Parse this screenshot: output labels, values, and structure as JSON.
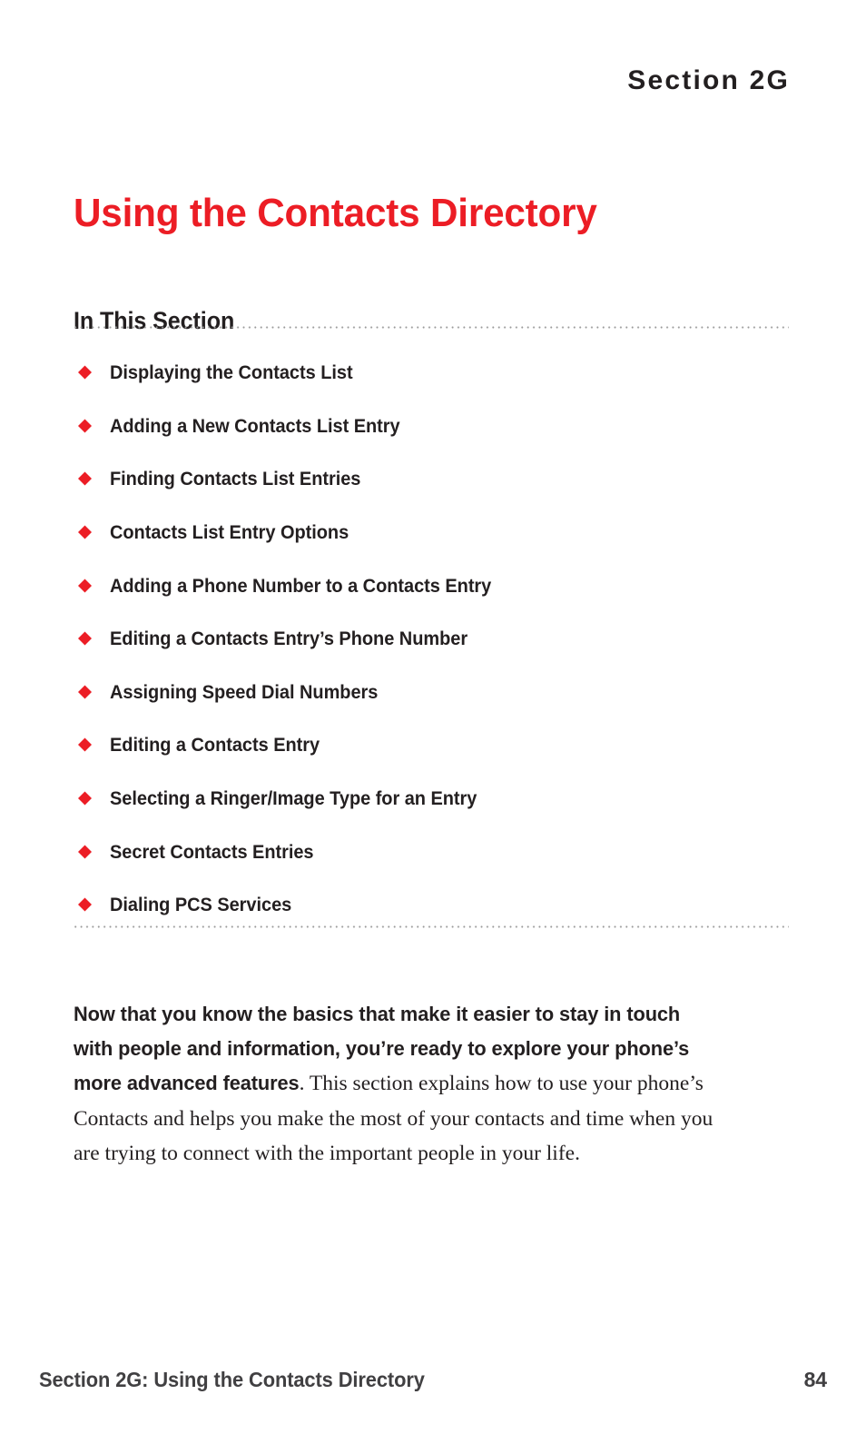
{
  "header": {
    "section_label": "Section 2G"
  },
  "title": {
    "text": "Using the Contacts Directory",
    "color": "#ec1d25"
  },
  "in_this_section": {
    "heading": "In This Section",
    "bullet_glyph": "diamond",
    "bullet_color": "#ec1d25",
    "items": [
      {
        "label": "Displaying the Contacts List"
      },
      {
        "label": "Adding a New Contacts List Entry"
      },
      {
        "label": "Finding Contacts List Entries"
      },
      {
        "label": "Contacts List Entry Options"
      },
      {
        "label": "Adding a Phone Number to a Contacts Entry"
      },
      {
        "label": "Editing a Contacts Entry’s Phone Number"
      },
      {
        "label": "Assigning Speed Dial Numbers"
      },
      {
        "label": "Editing a Contacts Entry"
      },
      {
        "label": "Selecting a Ringer/Image Type for an Entry"
      },
      {
        "label": "Secret Contacts Entries"
      },
      {
        "label": "Dialing PCS Services"
      }
    ]
  },
  "intro": {
    "lead": "Now that you know the basics that make it easier to stay in touch with people and information, you’re ready to explore your phone’s more advanced features",
    "rest": ". This section explains how to use your phone’s Contacts and helps you make the most of your contacts and time when you are trying to connect with the important people in your life."
  },
  "footer": {
    "left": "Section 2G: Using the Contacts Directory",
    "page_number": "84"
  }
}
